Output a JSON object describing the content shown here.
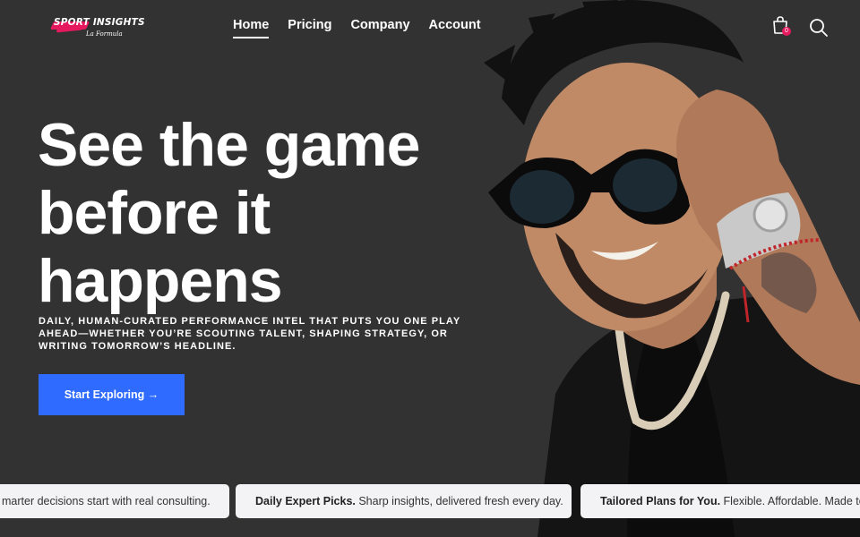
{
  "brand": {
    "name": "SPORT INSIGHTS",
    "tagline": "La Formula"
  },
  "nav": {
    "items": [
      {
        "label": "Home",
        "active": true
      },
      {
        "label": "Pricing",
        "active": false
      },
      {
        "label": "Company",
        "active": false
      },
      {
        "label": "Account",
        "active": false
      }
    ]
  },
  "header_icons": {
    "cart": {
      "icon": "shopping-bag-icon",
      "count": "0"
    },
    "search": {
      "icon": "search-icon"
    }
  },
  "hero": {
    "headline_lines": [
      "See the game",
      "before it",
      "happens"
    ],
    "subheading": "Daily, human-curated performance intel that puts you one play ahead—whether you’re scouting talent, shaping strategy, or writing tomorrow’s headline.",
    "cta_label": "Start Exploring →"
  },
  "ticker": [
    {
      "title": "",
      "text": "marter decisions start with real consulting."
    },
    {
      "title": "Daily Expert Picks.",
      "text": "Sharp insights, delivered fresh every day."
    },
    {
      "title": "Tailored Plans for You.",
      "text": "Flexible. Affordable. Made to fi"
    }
  ],
  "colors": {
    "background": "#323232",
    "accent_blue": "#2f6bff",
    "accent_pink": "#e5195d",
    "ticker_card": "#f3f3f5"
  }
}
